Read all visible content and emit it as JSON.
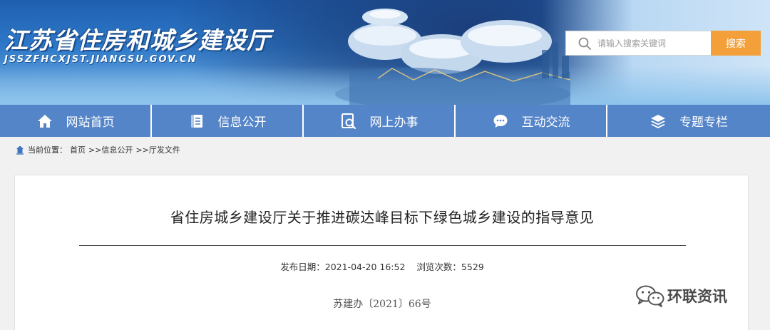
{
  "header": {
    "site_title": "江苏省住房和城乡建设厅",
    "site_url": "JSSZFHCXJST.JIANGSU.GOV.CN",
    "search_placeholder": "请输入搜索关键词",
    "search_button": "搜索"
  },
  "nav": [
    {
      "label": "网站首页",
      "icon": "home-icon"
    },
    {
      "label": "信息公开",
      "icon": "document-icon"
    },
    {
      "label": "网上办事",
      "icon": "search-document-icon"
    },
    {
      "label": "互动交流",
      "icon": "chat-icon"
    },
    {
      "label": "专题专栏",
      "icon": "layers-icon"
    }
  ],
  "breadcrumb": {
    "prefix": "当前位置：",
    "items": [
      "首页",
      ">>信息公开",
      ">>厅发文件"
    ]
  },
  "article": {
    "title": "省住房城乡建设厅关于推进碳达峰目标下绿色城乡建设的指导意见",
    "publish_label": "发布日期：",
    "publish_date": "2021-04-20 16:52",
    "views_label": "浏览次数：",
    "views": "5529",
    "doc_number": "苏建办〔2021〕66号"
  },
  "watermark": {
    "text": "环联资讯",
    "icon": "wechat-icon"
  },
  "colors": {
    "nav_bg": "#5585c9",
    "search_button": "#f4a03a",
    "banner": "#2e79c9"
  }
}
